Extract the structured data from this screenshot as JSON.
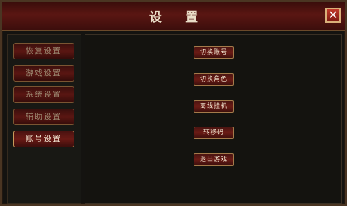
{
  "window": {
    "title": "设 置",
    "close_label": "✕"
  },
  "sidebar": {
    "items": [
      {
        "label": "恢复设置",
        "active": false
      },
      {
        "label": "游戏设置",
        "active": false
      },
      {
        "label": "系统设置",
        "active": false
      },
      {
        "label": "辅助设置",
        "active": false
      },
      {
        "label": "账号设置",
        "active": true
      }
    ]
  },
  "account": {
    "buttons": [
      {
        "label": "切换账号"
      },
      {
        "label": "切换角色"
      },
      {
        "label": "离线挂机"
      },
      {
        "label": "转移码"
      },
      {
        "label": "退出游戏"
      }
    ]
  }
}
